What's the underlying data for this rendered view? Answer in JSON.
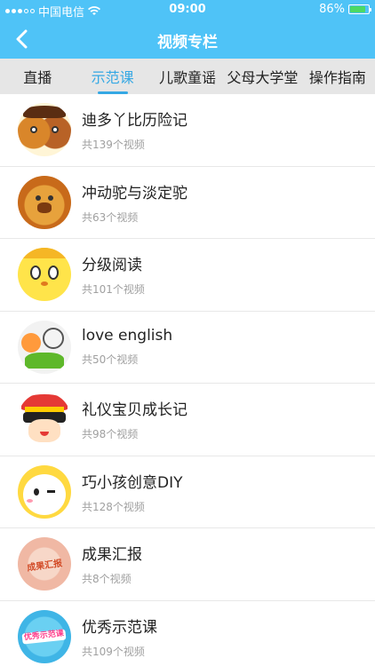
{
  "status_bar": {
    "carrier": "中国电信",
    "time": "09:00",
    "battery": "86%"
  },
  "navbar": {
    "title": "视频专栏",
    "back_icon": "chevron-left-icon"
  },
  "tabs": [
    {
      "label": "直播",
      "active": false
    },
    {
      "label": "示范课",
      "active": true
    },
    {
      "label": "儿歌童谣",
      "active": false
    },
    {
      "label": "父母大学堂",
      "active": false
    },
    {
      "label": "操作指南",
      "active": false
    }
  ],
  "colors": {
    "accent": "#35a8e4",
    "header": "#4fc3f7",
    "tab_bg": "#e6e6e6"
  },
  "items": [
    {
      "name": "迪多丫比历险记",
      "count": "共139个视频"
    },
    {
      "name": "冲动驼与淡定驼",
      "count": "共63个视频"
    },
    {
      "name": "分级阅读",
      "count": "共101个视频"
    },
    {
      "name": "love english",
      "count": "共50个视频"
    },
    {
      "name": "礼仪宝贝成长记",
      "count": "共98个视频"
    },
    {
      "name": "巧小孩创意DIY",
      "count": "共128个视频"
    },
    {
      "name": "成果汇报",
      "count": "共8个视频",
      "avatar_text": "成果汇报"
    },
    {
      "name": "优秀示范课",
      "count": "共109个视频",
      "avatar_text": "优秀示范课"
    }
  ]
}
